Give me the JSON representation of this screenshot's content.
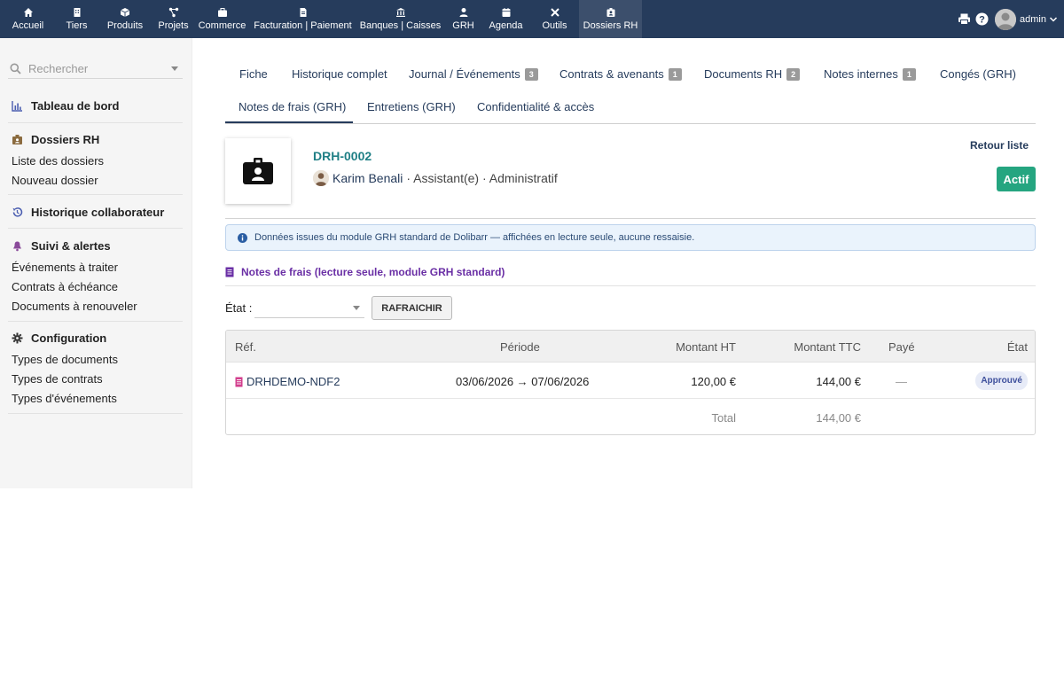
{
  "topnav": {
    "items": [
      {
        "label": "Accueil",
        "icon": "home-icon"
      },
      {
        "label": "Tiers",
        "icon": "building-icon"
      },
      {
        "label": "Produits",
        "icon": "cube-icon"
      },
      {
        "label": "Projets",
        "icon": "project-icon"
      },
      {
        "label": "Commerce",
        "icon": "briefcase-icon"
      },
      {
        "label": "Facturation | Paiement",
        "icon": "invoice-icon"
      },
      {
        "label": "Banques | Caisses",
        "icon": "bank-icon"
      },
      {
        "label": "GRH",
        "icon": "user-icon"
      },
      {
        "label": "Agenda",
        "icon": "calendar-icon"
      },
      {
        "label": "Outils",
        "icon": "tools-icon"
      },
      {
        "label": "Dossiers RH",
        "icon": "id-badge-icon",
        "active": true
      }
    ],
    "username": "admin"
  },
  "sidebar": {
    "search_placeholder": "Rechercher",
    "dashboard": "Tableau de bord",
    "dossiers_title": "Dossiers RH",
    "dossiers_links": [
      "Liste des dossiers",
      "Nouveau dossier"
    ],
    "historique": "Historique collaborateur",
    "suivi_title": "Suivi & alertes",
    "suivi_links": [
      "Événements à traiter",
      "Contrats à échéance",
      "Documents à renouveler"
    ],
    "config_title": "Configuration",
    "config_links": [
      "Types de documents",
      "Types de contrats",
      "Types d'événements"
    ]
  },
  "tabs": {
    "row1": [
      {
        "label": "Fiche"
      },
      {
        "label": "Historique complet"
      },
      {
        "label": "Journal / Événements",
        "badge": "3"
      },
      {
        "label": "Contrats & avenants",
        "badge": "1"
      },
      {
        "label": "Documents RH",
        "badge": "2"
      },
      {
        "label": "Notes internes",
        "badge": "1"
      },
      {
        "label": "Congés (GRH)"
      }
    ],
    "row2": [
      {
        "label": "Notes de frais (GRH)",
        "active": true
      },
      {
        "label": "Entretiens (GRH)"
      },
      {
        "label": "Confidentialité & accès"
      }
    ]
  },
  "header": {
    "ref": "DRH-0002",
    "name": "Karim Benali",
    "role": "· Assistant(e) · Administratif",
    "back_label": "Retour liste",
    "status": "Actif",
    "status_color": "#25a580"
  },
  "info_text": "Données issues du module GRH standard de Dolibarr — affichées en lecture seule, aucune ressaisie.",
  "section_title": "Notes de frais (lecture seule, module GRH standard)",
  "filter": {
    "label": "État :",
    "value": "",
    "button": "RAFRAICHIR"
  },
  "table": {
    "columns": [
      "Réf.",
      "Période",
      "Montant HT",
      "Montant TTC",
      "Payé",
      "État"
    ],
    "rows": [
      {
        "ref": "DRHDEMO-NDF2",
        "periode": "03/06/2026 → 07/06/2026",
        "ht": "120,00 €",
        "ttc": "144,00 €",
        "paye": "—",
        "etat": "Approuvé"
      }
    ],
    "total_label": "Total",
    "total_ttc": "144,00 €"
  },
  "colors": {
    "navbar": "#263c5c",
    "link": "#263c5c",
    "ref_teal": "#1f7f85",
    "section_purple": "#6a2fa5"
  }
}
